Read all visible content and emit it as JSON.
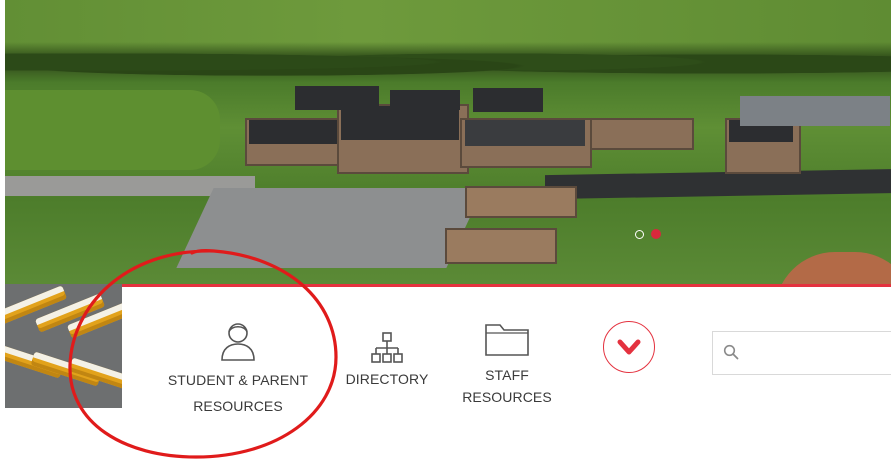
{
  "hero": {
    "carousel": {
      "slide_count": 2,
      "active_index": 1
    }
  },
  "resources": {
    "items": [
      {
        "label_line1": "STUDENT & PARENT",
        "label_line2": "RESOURCES",
        "icon": "person-icon"
      },
      {
        "label_line1": "DIRECTORY",
        "icon": "org-chart-icon"
      },
      {
        "label_line1": "STAFF",
        "label_line2": "RESOURCES",
        "icon": "folder-icon"
      }
    ],
    "expand_icon": "chevron-down-icon",
    "search": {
      "placeholder": "",
      "value": "",
      "icon": "search-icon"
    }
  },
  "colors": {
    "accent": "#e4323f",
    "text": "#3a3a3a",
    "annotation": "#e01b1b"
  }
}
